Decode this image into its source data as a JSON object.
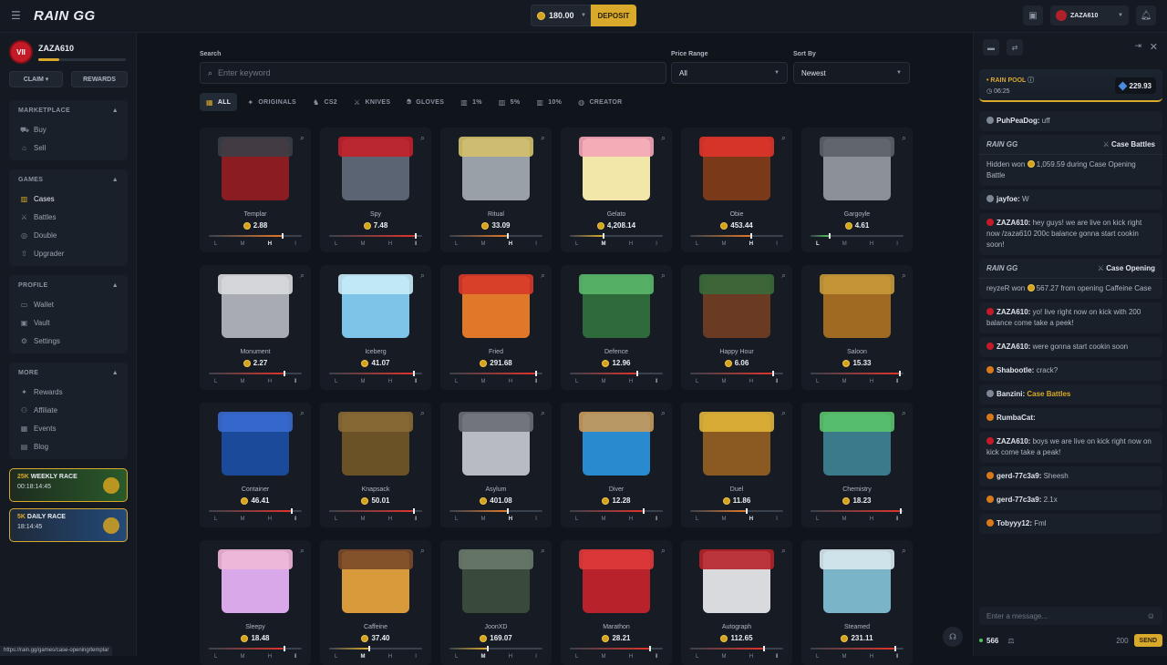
{
  "topbar": {
    "logo": "RAIN GG",
    "balance": "180.00",
    "deposit_label": "DEPOSIT",
    "username": "ZAZA610"
  },
  "sidebar": {
    "username": "ZAZA610",
    "level": "VII",
    "xp_progress": 0.24,
    "claim_label": "CLAIM ▾",
    "rewards_label": "REWARDS",
    "sections": [
      {
        "title": "MARKETPLACE",
        "items": [
          "Buy",
          "Sell"
        ]
      },
      {
        "title": "GAMES",
        "items": [
          "Cases",
          "Battles",
          "Double",
          "Upgrader"
        ]
      },
      {
        "title": "PROFILE",
        "items": [
          "Wallet",
          "Vault",
          "Settings"
        ]
      },
      {
        "title": "MORE",
        "items": [
          "Rewards",
          "Affiliate",
          "Events",
          "Blog"
        ]
      }
    ],
    "weekly_race": {
      "amount": "25K",
      "label": "WEEKLY RACE",
      "time": "00:18:14:45"
    },
    "daily_race": {
      "amount": "5K",
      "label": "DAILY RACE",
      "time": "18:14:45"
    }
  },
  "filters": {
    "search_label": "Search",
    "search_placeholder": "Enter keyword",
    "price_label": "Price Range",
    "price_value": "All",
    "sort_label": "Sort By",
    "sort_value": "Newest",
    "chips": [
      "ALL",
      "ORIGINALS",
      "CS2",
      "KNIVES",
      "GLOVES",
      "1%",
      "5%",
      "10%",
      "CREATOR"
    ]
  },
  "volatility_labels": [
    "L",
    "M",
    "H",
    "I"
  ],
  "cases": [
    {
      "name": "Templar",
      "price": "2.88",
      "vol": 0.78,
      "level": "H",
      "color": "#8a1c22",
      "lid": "#3a3f47"
    },
    {
      "name": "Spy",
      "price": "7.48",
      "vol": 0.92,
      "level": "I",
      "color": "#5a6472",
      "lid": "#c4202a"
    },
    {
      "name": "Ritual",
      "price": "33.09",
      "vol": 0.62,
      "level": "H",
      "color": "#9aa0a8",
      "lid": "#d4c06a"
    },
    {
      "name": "Gelato",
      "price": "4,208.14",
      "vol": 0.35,
      "level": "M",
      "color": "#f2e6a8",
      "lid": "#f4a6b8"
    },
    {
      "name": "Obie",
      "price": "453.44",
      "vol": 0.65,
      "level": "H",
      "color": "#7a3a1a",
      "lid": "#e0342a"
    },
    {
      "name": "Gargoyle",
      "price": "4.61",
      "vol": 0.2,
      "level": "L",
      "color": "#8c9098",
      "lid": "#5c6068"
    },
    {
      "name": "Monument",
      "price": "2.27",
      "vol": 0.8,
      "level": "I",
      "color": "#a8acb2",
      "lid": "#d8dadd"
    },
    {
      "name": "Iceberg",
      "price": "41.07",
      "vol": 0.9,
      "level": "I",
      "color": "#7ec4e8",
      "lid": "#c8ecf8"
    },
    {
      "name": "Fried",
      "price": "291.68",
      "vol": 0.92,
      "level": "I",
      "color": "#e0782a",
      "lid": "#d83a2a"
    },
    {
      "name": "Defence",
      "price": "12.96",
      "vol": 0.72,
      "level": "I",
      "color": "#2f6a3a",
      "lid": "#5ab86a"
    },
    {
      "name": "Happy Hour",
      "price": "6.06",
      "vol": 0.88,
      "level": "I",
      "color": "#6a3a22",
      "lid": "#3a6a3a"
    },
    {
      "name": "Saloon",
      "price": "15.33",
      "vol": 0.95,
      "level": "I",
      "color": "#a06a22",
      "lid": "#c89a3a"
    },
    {
      "name": "Container",
      "price": "46.41",
      "vol": 0.88,
      "level": "I",
      "color": "#1c4a9a",
      "lid": "#3a6ad0"
    },
    {
      "name": "Knapsack",
      "price": "50.01",
      "vol": 0.9,
      "level": "I",
      "color": "#6a5226",
      "lid": "#8a6a36"
    },
    {
      "name": "Asylum",
      "price": "401.08",
      "vol": 0.62,
      "level": "H",
      "color": "#b8bcc2",
      "lid": "#6a6e74"
    },
    {
      "name": "Diver",
      "price": "12.28",
      "vol": 0.78,
      "level": "I",
      "color": "#2a8ad0",
      "lid": "#c89a5a"
    },
    {
      "name": "Duel",
      "price": "11.86",
      "vol": 0.6,
      "level": "H",
      "color": "#8a5a22",
      "lid": "#e0b43a"
    },
    {
      "name": "Chemistry",
      "price": "18.23",
      "vol": 0.96,
      "level": "I",
      "color": "#3a7a8a",
      "lid": "#5ac46a"
    },
    {
      "name": "Sleepy",
      "price": "18.48",
      "vol": 0.8,
      "level": "I",
      "color": "#d8a8e8",
      "lid": "#f0b8d8"
    },
    {
      "name": "Caffeine",
      "price": "37.40",
      "vol": 0.42,
      "level": "M",
      "color": "#d89a3a",
      "lid": "#7a4a2a"
    },
    {
      "name": "JoonXD",
      "price": "169.07",
      "vol": 0.4,
      "level": "M",
      "color": "#3a4a3a",
      "lid": "#6a7a6a"
    },
    {
      "name": "Marathon",
      "price": "28.21",
      "vol": 0.85,
      "level": "I",
      "color": "#b8222a",
      "lid": "#e03a3a"
    },
    {
      "name": "Autograph",
      "price": "112.65",
      "vol": 0.78,
      "level": "I",
      "color": "#d8dade",
      "lid": "#b8222a"
    },
    {
      "name": "Steamed",
      "price": "231.11",
      "vol": 0.9,
      "level": "I",
      "color": "#7ab4c8",
      "lid": "#d8e8ee"
    }
  ],
  "chat": {
    "rain_pool_label": "RAIN POOL",
    "rain_pool_time": "06:25",
    "rain_pool_amount": "229.93",
    "messages": [
      {
        "kind": "user",
        "user": "PuhPeaDog:",
        "text": "uff",
        "badge": "grey"
      },
      {
        "kind": "system",
        "logo": "RAIN GG",
        "type": "Case Battles",
        "user": "Hidden",
        "verb": "won",
        "amount": "1,059.59",
        "tail": "during Case Opening Battle"
      },
      {
        "kind": "user",
        "user": "jayfoe:",
        "text": "W",
        "badge": "grey"
      },
      {
        "kind": "user",
        "user": "ZAZA610:",
        "text": "hey guys! we are live on kick right now /zaza610 200c balance gonna start cookin soon!",
        "badge": "red"
      },
      {
        "kind": "system",
        "logo": "RAIN GG",
        "type": "Case Opening",
        "user": "reyzeR",
        "verb": "won",
        "amount": "567.27",
        "tail": "from opening Caffeine Case"
      },
      {
        "kind": "user",
        "user": "ZAZA610:",
        "text": "yo! live right now on kick with 200 balance come take a peek!",
        "badge": "red"
      },
      {
        "kind": "user",
        "user": "ZAZA610:",
        "text": "were gonna start cookin soon",
        "badge": "red"
      },
      {
        "kind": "user",
        "user": "Shabootle:",
        "text": "crack?",
        "badge": "orange"
      },
      {
        "kind": "user",
        "user": "Banzini:",
        "text": "Case Battles",
        "badge": "grey",
        "highlight": true
      },
      {
        "kind": "user",
        "user": "RumbaCat:",
        "text": "",
        "badge": "orange"
      },
      {
        "kind": "user",
        "user": "ZAZA610:",
        "text": "boys we are live on kick right now on kick come take a peak!",
        "badge": "red"
      },
      {
        "kind": "user",
        "user": "gerd-77c3a9:",
        "text": "Sheesh",
        "badge": "orange"
      },
      {
        "kind": "user",
        "user": "gerd-77c3a9:",
        "text": "2.1x",
        "badge": "orange"
      },
      {
        "kind": "user",
        "user": "Tobyyy12:",
        "text": "Fml",
        "badge": "orange"
      }
    ],
    "input_placeholder": "Enter a message...",
    "online": "566",
    "char_limit": "200",
    "send_label": "SEND"
  },
  "status_url": "https://rain.gg/games/case-opening/templar",
  "colors": {
    "accent": "#d9a92b",
    "bg": "#10141b",
    "panel": "#171c24",
    "win": "#4ec25a"
  }
}
